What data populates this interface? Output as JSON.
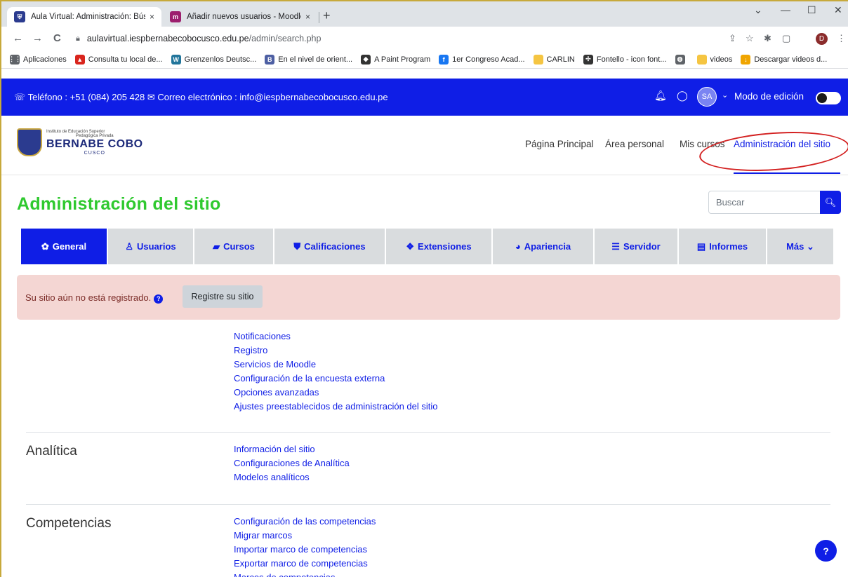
{
  "browser": {
    "tabs": [
      {
        "title": "Aula Virtual: Administración: Bús",
        "close": "×",
        "favicon_color": "#2b3b8f"
      },
      {
        "title": "Añadir nuevos usuarios - Moodle",
        "close": "×",
        "favicon_color": "#9c1f6e"
      }
    ],
    "new_tab": "+",
    "window_controls": {
      "collapse": "⌄",
      "minimize": "—",
      "maximize": "☐",
      "close": "✕"
    },
    "nav": {
      "back": "←",
      "forward": "→",
      "reload": "C"
    },
    "address": {
      "host": "aulavirtual.iespbernabecobocusco.edu.pe",
      "path": "/admin/search.php"
    },
    "profile_initial": "D",
    "bookmarks": [
      {
        "label": "Aplicaciones",
        "icon": "apps-grid-icon",
        "color": "#5f6368"
      },
      {
        "label": "Consulta tu local de...",
        "icon": "onpe-icon",
        "color": "#d9251d"
      },
      {
        "label": "Grenzenlos Deutsc...",
        "icon": "wordpress-icon",
        "color": "#21759b"
      },
      {
        "label": "En el nivel de orient...",
        "icon": "b-icon",
        "color": "#4d5fa3"
      },
      {
        "label": "A Paint Program",
        "icon": "paint-icon",
        "color": "#333333"
      },
      {
        "label": "1er Congreso Acad...",
        "icon": "facebook-icon",
        "color": "#1877f2"
      },
      {
        "label": "CARLIN",
        "icon": "folder-icon",
        "color": "#f5c542"
      },
      {
        "label": "Fontello - icon font...",
        "icon": "fontello-icon",
        "color": "#333333"
      },
      {
        "label": "",
        "icon": "globe-icon",
        "color": "#5f6368"
      },
      {
        "label": "videos",
        "icon": "folder-icon",
        "color": "#f5c542"
      },
      {
        "label": "Descargar videos d...",
        "icon": "download-icon",
        "color": "#f0a500"
      }
    ]
  },
  "topbar": {
    "contact": "☏ Teléfono : +51 (084) 205 428  ✉ Correo electrónico : info@iespbernabecobocusco.edu.pe",
    "user_initials": "SA",
    "edit_mode_label": "Modo de edición",
    "edit_mode_on": false
  },
  "logo": {
    "line1": "Instituto de Educación Superior",
    "line2": "Pedagógica Privada",
    "name": "BERNABE COBO",
    "city": "CUSCO"
  },
  "nav": {
    "items": [
      "Página Principal",
      "Área personal",
      "Mis cursos",
      "Administración del sitio"
    ],
    "active_index": 3
  },
  "page": {
    "title": "Administración del sitio",
    "search_placeholder": "Buscar"
  },
  "tabs": [
    {
      "label": "General",
      "icon": "gear-icon"
    },
    {
      "label": "Usuarios",
      "icon": "user-icon"
    },
    {
      "label": "Cursos",
      "icon": "book-icon"
    },
    {
      "label": "Calificaciones",
      "icon": "shield-icon"
    },
    {
      "label": "Extensiones",
      "icon": "puzzle-icon"
    },
    {
      "label": "Apariencia",
      "icon": "palette-icon"
    },
    {
      "label": "Servidor",
      "icon": "database-icon"
    },
    {
      "label": "Informes",
      "icon": "report-icon"
    },
    {
      "label": "Más ⌄",
      "icon": ""
    }
  ],
  "alert": {
    "message": "Su sitio aún no está registrado.",
    "button": "Registre su sitio"
  },
  "sections": [
    {
      "heading": "",
      "links": [
        "Notificaciones",
        "Registro",
        "Servicios de Moodle",
        "Configuración de la encuesta externa",
        "Opciones avanzadas",
        "Ajustes preestablecidos de administración del sitio"
      ]
    },
    {
      "heading": "Analítica",
      "links": [
        "Información del sitio",
        "Configuraciones de Analítica",
        "Modelos analíticos"
      ]
    },
    {
      "heading": "Competencias",
      "links": [
        "Configuración de las competencias",
        "Migrar marcos",
        "Importar marco de competencias",
        "Exportar marco de competencias",
        "Marcos de competencias"
      ]
    }
  ],
  "help_fab": "?"
}
